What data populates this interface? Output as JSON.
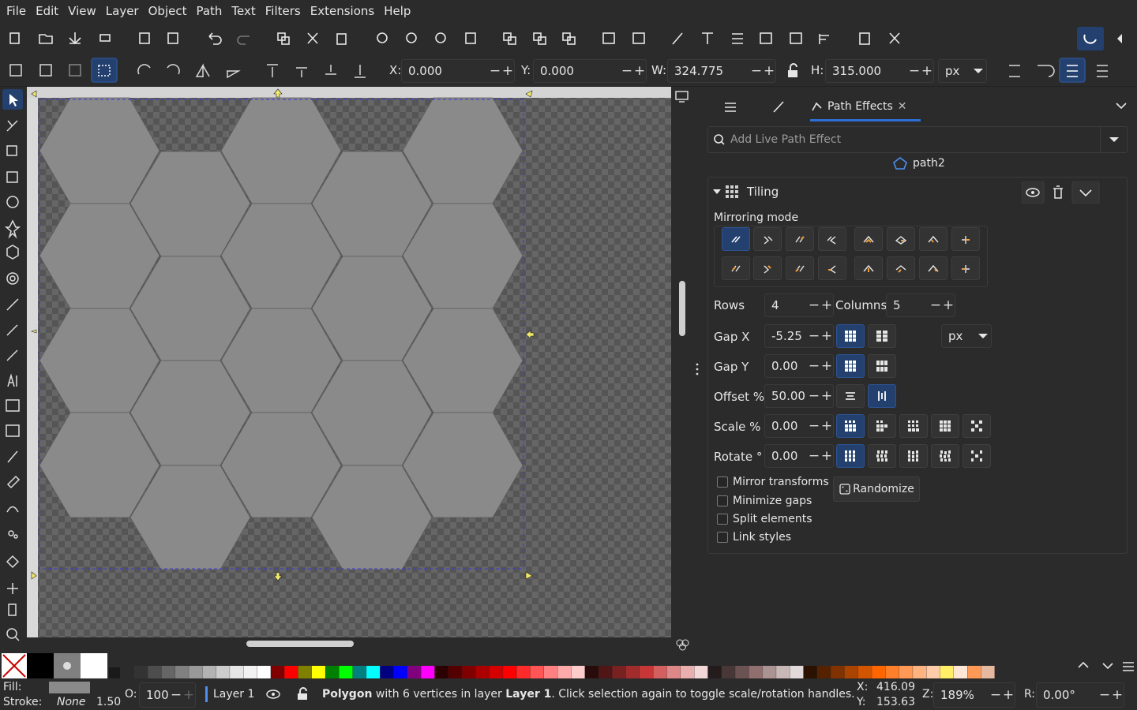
{
  "menu": [
    "File",
    "Edit",
    "View",
    "Layer",
    "Object",
    "Path",
    "Text",
    "Filters",
    "Extensions",
    "Help"
  ],
  "toolbar": {
    "x_label": "X:",
    "x_value": "0.000",
    "y_label": "Y:",
    "y_value": "0.000",
    "w_label": "W:",
    "w_value": "324.775",
    "h_label": "H:",
    "h_value": "315.000",
    "unit": "px"
  },
  "panel": {
    "tab_label": "Path Effects",
    "search_placeholder": "Add Live Path Effect",
    "object_name": "path2",
    "effect_name": "Tiling",
    "mirroring_label": "Mirroring mode",
    "rows_label": "Rows",
    "rows_value": "4",
    "columns_label": "Columns",
    "columns_value": "5",
    "gapx_label": "Gap X",
    "gapx_value": "-5.25",
    "gapy_label": "Gap Y",
    "gapy_value": "0.00",
    "unit": "px",
    "offset_label": "Offset %",
    "offset_value": "50.00",
    "scale_label": "Scale %",
    "scale_value": "0.00",
    "rotate_label": "Rotate °",
    "rotate_value": "0.00",
    "mirror_transforms": "Mirror transforms",
    "randomize": "Randomize",
    "minimize_gaps": "Minimize gaps",
    "split_elements": "Split elements",
    "link_styles": "Link styles"
  },
  "status": {
    "fill_label": "Fill:",
    "stroke_label": "Stroke:",
    "stroke_value": "None",
    "stroke_width": "1.50",
    "opacity_label": "O:",
    "opacity_value": "100",
    "layer": "Layer 1",
    "message_bold": "Polygon",
    "message_rest": " with 6 vertices in layer ",
    "message_layer": "Layer 1",
    "message_tail": ". Click selection again to toggle scale/rotation handles.",
    "cursor_x_label": "X:",
    "cursor_x": "416.09",
    "cursor_y_label": "Y:",
    "cursor_y": "153.63",
    "zoom_label": "Z:",
    "zoom": "189%",
    "rotation_label": "R:",
    "rotation": "0.00°"
  },
  "colors": {
    "accent": "#23406e",
    "hex_fill": "#8a8a8a",
    "selection": "#3b3bd6"
  }
}
